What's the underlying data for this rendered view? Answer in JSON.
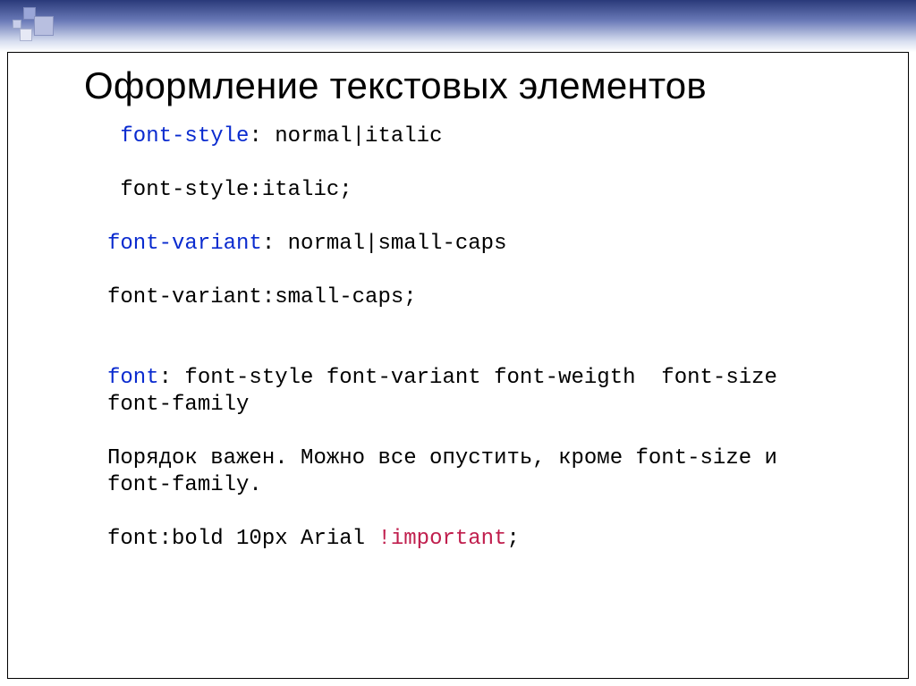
{
  "title": "Оформление текстовых элементов",
  "lines": {
    "l1_prop": "font-style",
    "l1_rest": ": normal|italic",
    "l2": " font-style:italic;",
    "l3_prop": "font-variant",
    "l3_rest": ": normal|small-caps",
    "l4": "font-variant:small-caps;",
    "l5_prop": "font",
    "l5_rest": ": font-style font-variant font-weigth  font-size font-family",
    "l6": "Порядок важен. Можно все опустить, кроме font-size и font-family.",
    "l7_a": "font:bold 10px Arial ",
    "l7_imp": "!important",
    "l7_b": ";"
  }
}
